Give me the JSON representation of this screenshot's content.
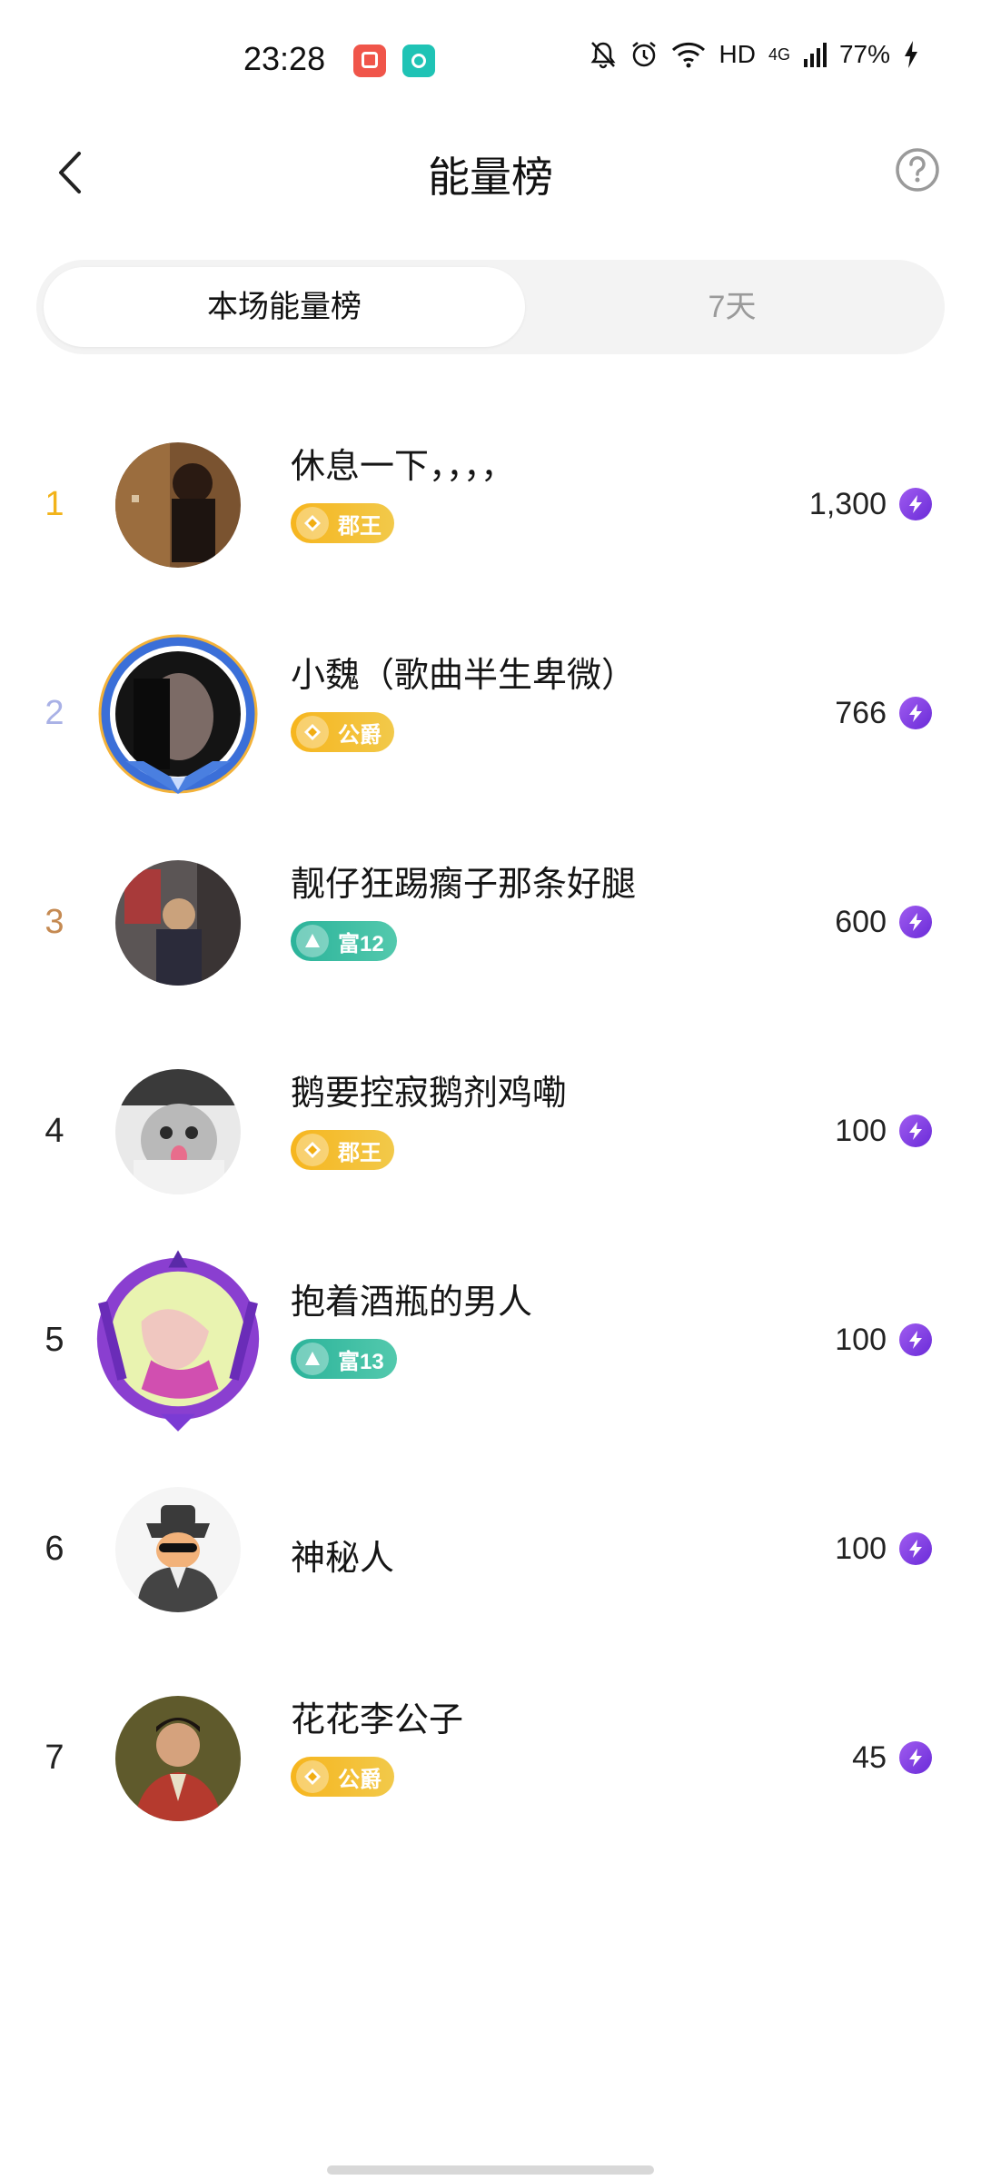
{
  "status_bar": {
    "time": "23:28",
    "network": "HD",
    "signal": "4G",
    "battery": "77%"
  },
  "header": {
    "title": "能量榜",
    "back_icon": "chevron-left-icon",
    "help_icon": "question-circle-icon"
  },
  "tabs": [
    {
      "label": "本场能量榜",
      "active": true
    },
    {
      "label": "7天",
      "active": false
    }
  ],
  "ranking": [
    {
      "rank": "1",
      "name": "休息一下，，，，",
      "badge": "郡王",
      "badge_type": "gold",
      "score": "1,300",
      "rank_color": "#f2b31a"
    },
    {
      "rank": "2",
      "name": "小魏（歌曲半生卑微）",
      "badge": "公爵",
      "badge_type": "gold",
      "score": "766",
      "rank_color": "#a9b1e6"
    },
    {
      "rank": "3",
      "name": "靓仔狂踢瘸子那条好腿",
      "badge": "富12",
      "badge_type": "green",
      "score": "600",
      "rank_color": "#c58a52"
    },
    {
      "rank": "4",
      "name": "鹅要控寂鹅剂鸡嘞",
      "badge": "郡王",
      "badge_type": "gold",
      "score": "100",
      "rank_color": "#222222"
    },
    {
      "rank": "5",
      "name": "抱着酒瓶的男人",
      "badge": "富13",
      "badge_type": "green",
      "score": "100",
      "rank_color": "#222222"
    },
    {
      "rank": "6",
      "name": "神秘人",
      "badge": "",
      "badge_type": "none",
      "score": "100",
      "rank_color": "#222222"
    },
    {
      "rank": "7",
      "name": "花花李公子",
      "badge": "公爵",
      "badge_type": "gold",
      "score": "45",
      "rank_color": "#222222"
    }
  ],
  "colors": {
    "tab_bg": "#f3f3f3",
    "energy_purple": "#8a46e6",
    "badge_gold": "#f6b51e",
    "badge_green": "#2bb39a"
  }
}
